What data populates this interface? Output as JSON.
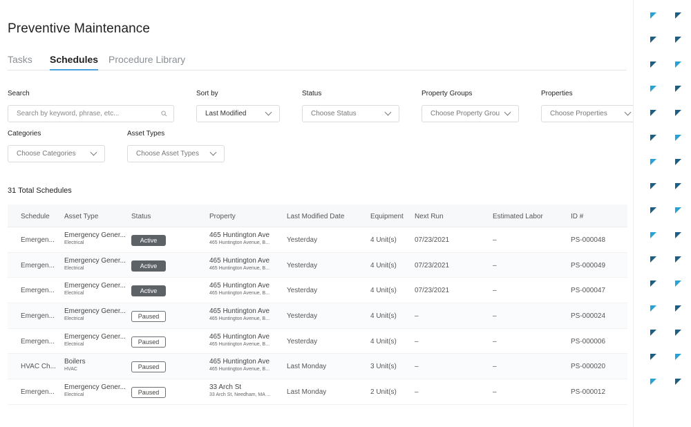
{
  "page": {
    "title": "Preventive Maintenance"
  },
  "tabs": [
    {
      "label": "Tasks"
    },
    {
      "label": "Schedules"
    },
    {
      "label": "Procedure Library"
    }
  ],
  "filters": {
    "search": {
      "label": "Search",
      "placeholder": "Search by keyword, phrase, etc..."
    },
    "sort_by": {
      "label": "Sort by",
      "value": "Last Modified"
    },
    "status": {
      "label": "Status",
      "placeholder": "Choose Status"
    },
    "property_groups": {
      "label": "Property Groups",
      "placeholder": "Choose Property Grou"
    },
    "properties": {
      "label": "Properties",
      "placeholder": "Choose Properties"
    },
    "categories": {
      "label": "Categories",
      "placeholder": "Choose Categories"
    },
    "asset_types": {
      "label": "Asset Types",
      "placeholder": "Choose Asset Types"
    }
  },
  "summary": {
    "total": "31 Total Schedules"
  },
  "table": {
    "columns": [
      "Schedule",
      "Asset Type",
      "Status",
      "Property",
      "Last Modified Date",
      "Equipment",
      "Next Run",
      "Estimated Labor",
      "ID #"
    ],
    "rows": [
      {
        "schedule": "Emergen...",
        "asset": "Emergency Gener...",
        "asset_sub": "Electrical",
        "status": "Active",
        "property": "465 Huntington Ave",
        "property_sub": "465 Huntington Avenue, B...",
        "modified": "Yesterday",
        "equipment": "4 Unit(s)",
        "next_run": "07/23/2021",
        "labor": "–",
        "id": "PS-000048"
      },
      {
        "schedule": "Emergen...",
        "asset": "Emergency Gener...",
        "asset_sub": "Electrical",
        "status": "Active",
        "property": "465 Huntington Ave",
        "property_sub": "465 Huntington Avenue, B...",
        "modified": "Yesterday",
        "equipment": "4 Unit(s)",
        "next_run": "07/23/2021",
        "labor": "–",
        "id": "PS-000049"
      },
      {
        "schedule": "Emergen...",
        "asset": "Emergency Gener...",
        "asset_sub": "Electrical",
        "status": "Active",
        "property": "465 Huntington Ave",
        "property_sub": "465 Huntington Avenue, B...",
        "modified": "Yesterday",
        "equipment": "4 Unit(s)",
        "next_run": "07/23/2021",
        "labor": "–",
        "id": "PS-000047"
      },
      {
        "schedule": "Emergen...",
        "asset": "Emergency Gener...",
        "asset_sub": "Electrical",
        "status": "Paused",
        "property": "465 Huntington Ave",
        "property_sub": "465 Huntington Avenue, B...",
        "modified": "Yesterday",
        "equipment": "4 Unit(s)",
        "next_run": "–",
        "labor": "–",
        "id": "PS-000024"
      },
      {
        "schedule": "Emergen...",
        "asset": "Emergency Gener...",
        "asset_sub": "Electrical",
        "status": "Paused",
        "property": "465 Huntington Ave",
        "property_sub": "465 Huntington Avenue, B...",
        "modified": "Yesterday",
        "equipment": "4 Unit(s)",
        "next_run": "–",
        "labor": "–",
        "id": "PS-000006"
      },
      {
        "schedule": "HVAC Ch...",
        "asset": "Boilers",
        "asset_sub": "HVAC",
        "status": "Paused",
        "property": "465 Huntington Ave",
        "property_sub": "465 Huntington Avenue, B...",
        "modified": "Last Monday",
        "equipment": "3 Unit(s)",
        "next_run": "–",
        "labor": "–",
        "id": "PS-000020"
      },
      {
        "schedule": "Emergen...",
        "asset": "Emergency Gener...",
        "asset_sub": "Electrical",
        "status": "Paused",
        "property": "33 Arch St",
        "property_sub": "33 Arch St, Needham, MA ...",
        "modified": "Last Monday",
        "equipment": "2 Unit(s)",
        "next_run": "–",
        "labor": "–",
        "id": "PS-000012"
      }
    ]
  },
  "colors": {
    "tab_underline": "#4aa3df",
    "badge_active": "#5d6266",
    "triangle_dark": "#1a5f88",
    "triangle_light": "#22a3db"
  }
}
